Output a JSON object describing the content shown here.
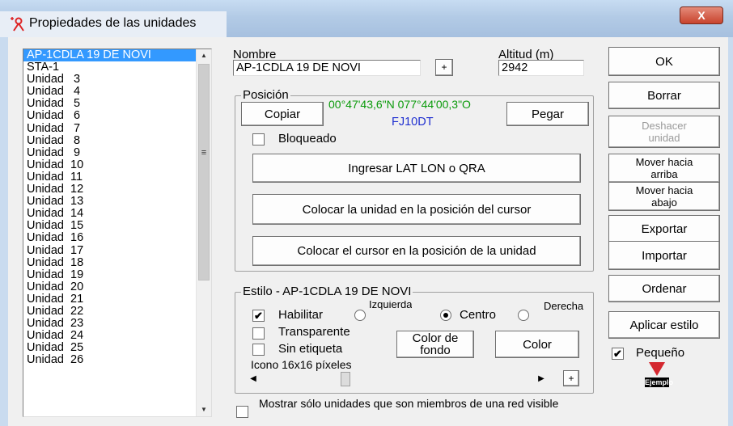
{
  "window": {
    "title": "Propiedades de las unidades",
    "close_label": "X"
  },
  "unit_list": {
    "items": [
      {
        "label": "AP-1CDLA 19 DE NOVI",
        "selected": true
      },
      {
        "label": "STA-1"
      },
      {
        "label": "Unidad   3"
      },
      {
        "label": "Unidad   4"
      },
      {
        "label": "Unidad   5"
      },
      {
        "label": "Unidad   6"
      },
      {
        "label": "Unidad   7"
      },
      {
        "label": "Unidad   8"
      },
      {
        "label": "Unidad   9"
      },
      {
        "label": "Unidad  10"
      },
      {
        "label": "Unidad  11"
      },
      {
        "label": "Unidad  12"
      },
      {
        "label": "Unidad  13"
      },
      {
        "label": "Unidad  14"
      },
      {
        "label": "Unidad  15"
      },
      {
        "label": "Unidad  16"
      },
      {
        "label": "Unidad  17"
      },
      {
        "label": "Unidad  18"
      },
      {
        "label": "Unidad  19"
      },
      {
        "label": "Unidad  20"
      },
      {
        "label": "Unidad  21"
      },
      {
        "label": "Unidad  22"
      },
      {
        "label": "Unidad  23"
      },
      {
        "label": "Unidad  24"
      },
      {
        "label": "Unidad  25"
      },
      {
        "label": "Unidad  26"
      }
    ]
  },
  "name": {
    "label": "Nombre",
    "value": "AP-1CDLA 19 DE NOVI",
    "plus": "+"
  },
  "altitude": {
    "label": "Altitud (m)",
    "value": "2942"
  },
  "position": {
    "caption": "Posición",
    "copy": "Copiar",
    "paste": "Pegar",
    "coords": "00°47'43,6\"N 077°44'00,3\"O",
    "qra": "FJ10DT",
    "locked_label": "Bloqueado",
    "locked": false,
    "enter_button": "Ingresar LAT LON o QRA",
    "unit_to_cursor": "Colocar la unidad en la posición del cursor",
    "cursor_to_unit": "Colocar el cursor en la posición de la unidad"
  },
  "style": {
    "caption": "Estilo - AP-1CDLA 19 DE NOVI",
    "enable_label": "Habilitar",
    "enabled": true,
    "align_left": "Izquierda",
    "align_center": "Centro",
    "align_right": "Derecha",
    "transparent_label": "Transparente",
    "no_label_label": "Sin etiqueta",
    "bg_color_button": "Color de fondo",
    "color_button": "Color",
    "icon_size_label": "Icono 16x16 píxeles",
    "plus": "+"
  },
  "bottom": {
    "visible_members_label": "Mostrar sólo unidades que son miembros de una red visible"
  },
  "side_buttons": {
    "ok": "OK",
    "delete": "Borrar",
    "undo": "Deshacer unidad",
    "move_up": "Mover hacia arriba",
    "move_down": "Mover hacia abajo",
    "export": "Exportar",
    "import": "Importar",
    "sort": "Ordenar",
    "apply_style": "Aplicar estilo",
    "small_label": "Pequeño",
    "small_checked": true,
    "example": "Ejemplo"
  },
  "colors": {
    "selection": "#3399ff",
    "coords": "#0a9a0a",
    "qra": "#2030d0",
    "close": "#c8432d"
  }
}
